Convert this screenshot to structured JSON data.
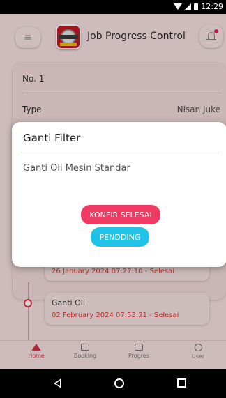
{
  "status_bar": {
    "time": "12:29"
  },
  "header": {
    "title": "Job Progress Control"
  },
  "detail_card": {
    "rows": [
      {
        "label": "No. 1",
        "value": ""
      },
      {
        "label": "Type",
        "value": "Nisan Juke"
      }
    ]
  },
  "timeline": [
    {
      "name": "",
      "datetime": "26 January 2024 07:27:10 - Selesai"
    },
    {
      "name": "Ganti Oli",
      "datetime": "02 February 2024 07:53:21 - Selesai"
    }
  ],
  "dialog": {
    "title": "Ganti Filter",
    "body": "Ganti Oli Mesin Standar",
    "confirm_label": "KONFIR SELESAI",
    "pending_label": "PENDDING"
  },
  "bottom_nav": [
    {
      "label": "Home",
      "icon": "home-icon",
      "active": true
    },
    {
      "label": "Booking",
      "icon": "booking-icon",
      "active": false
    },
    {
      "label": "Progres",
      "icon": "progress-icon",
      "active": false
    },
    {
      "label": "User",
      "icon": "user-icon",
      "active": false
    }
  ],
  "colors": {
    "accent": "#ef3b63",
    "secondary": "#1fc3e6",
    "background": "#fce6e6"
  }
}
